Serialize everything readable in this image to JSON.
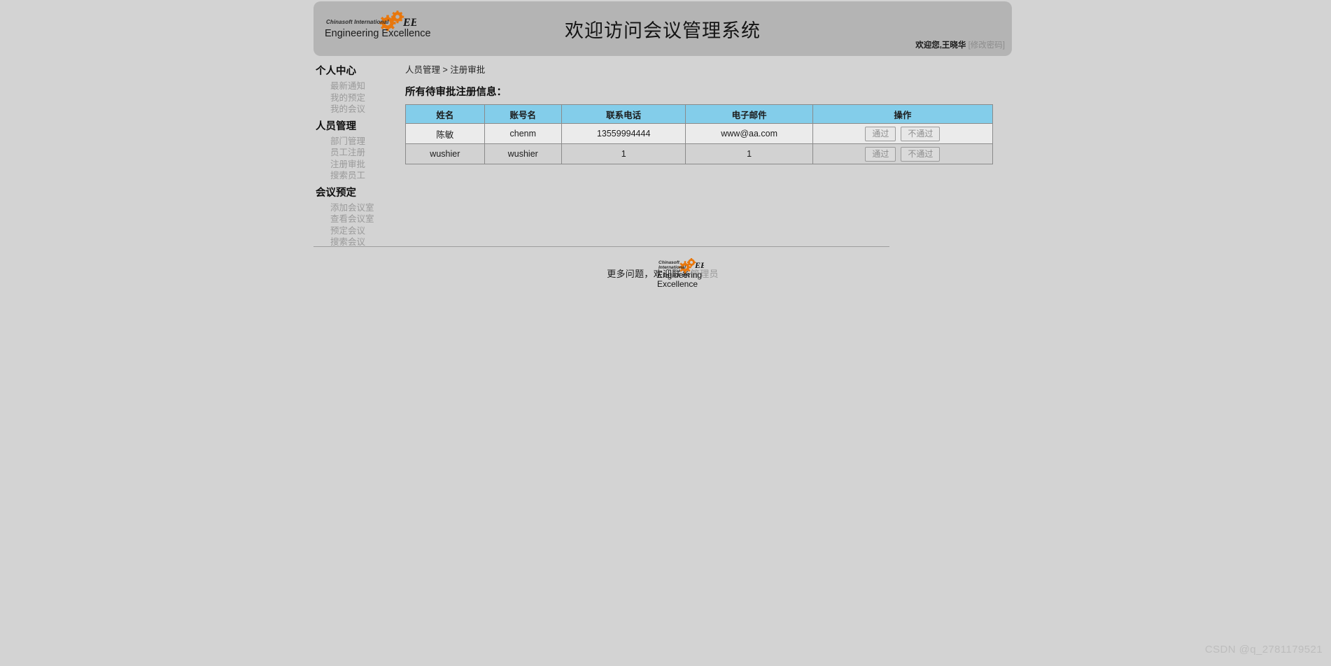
{
  "header": {
    "title": "欢迎访问会议管理系统",
    "welcome_prefix": "欢迎您,",
    "user_name": "王晓华",
    "change_password_label": "[修改密码]",
    "logo_sub": "Chinasoft International",
    "logo_main": "Engineering Excellence"
  },
  "sidebar": {
    "groups": [
      {
        "title": "个人中心",
        "items": [
          {
            "label": "最新通知"
          },
          {
            "label": "我的预定"
          },
          {
            "label": "我的会议"
          }
        ]
      },
      {
        "title": "人员管理",
        "items": [
          {
            "label": "部门管理"
          },
          {
            "label": "员工注册"
          },
          {
            "label": "注册审批"
          },
          {
            "label": "搜索员工"
          }
        ]
      },
      {
        "title": "会议预定",
        "items": [
          {
            "label": "添加会议室"
          },
          {
            "label": "查看会议室"
          },
          {
            "label": "预定会议"
          },
          {
            "label": "搜索会议"
          }
        ]
      }
    ]
  },
  "main": {
    "breadcrumb": "人员管理 > 注册审批",
    "panel_title": "所有待审批注册信息：",
    "table": {
      "columns": [
        "姓名",
        "账号名",
        "联系电话",
        "电子邮件",
        "操作"
      ],
      "rows": [
        {
          "name": "陈敏",
          "account": "chenm",
          "phone": "13559994444",
          "email": "www@aa.com",
          "approve_label": "通过",
          "reject_label": "不通过"
        },
        {
          "name": "wushier",
          "account": "wushier",
          "phone": "1",
          "email": "1",
          "approve_label": "通过",
          "reject_label": "不通过"
        }
      ]
    }
  },
  "footer": {
    "text_prefix": "更多问题，欢迎联系",
    "admin_label": "管理员",
    "logo_sub_line1": "Chinasoft",
    "logo_sub_line2": "International",
    "logo_main_line1": "Engineering",
    "logo_main_line2": "Excellence"
  },
  "watermark": {
    "text": "CSDN @q_2781179521"
  },
  "colors": {
    "page_background": "#d3d3d3",
    "header_bar": "#b4b4b4",
    "table_header": "#83cdea",
    "row_odd": "#ebebeb",
    "row_even": "#d2d2d2",
    "muted_text": "#9a9a9a",
    "gear_orange": "#e8770d"
  }
}
